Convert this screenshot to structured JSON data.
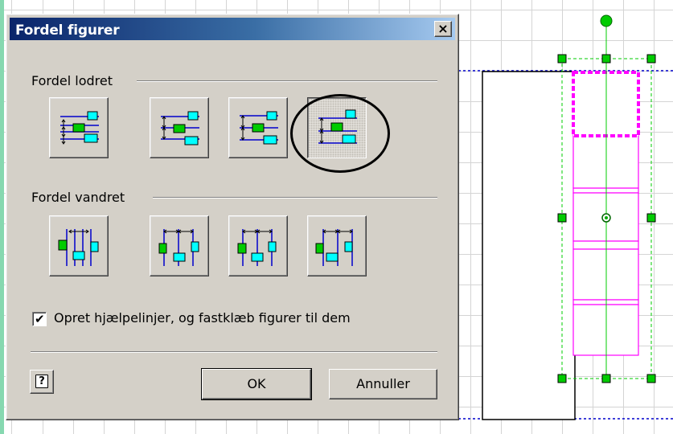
{
  "dialog": {
    "title": "Fordel figurer",
    "close_label": "×",
    "vertical_section_label": "Fordel lodret",
    "horizontal_section_label": "Fordel vandret",
    "vertical_buttons": [
      "distribute-vertical-space-icon",
      "distribute-vertical-top-icon",
      "distribute-vertical-center-icon",
      "distribute-vertical-bottom-icon"
    ],
    "horizontal_buttons": [
      "distribute-horizontal-space-icon",
      "distribute-horizontal-left-icon",
      "distribute-horizontal-center-icon",
      "distribute-horizontal-right-icon"
    ],
    "selected_vertical_option": 4,
    "checkbox": {
      "label": "Opret hjælpelinjer, og fastklæb figurer til dem",
      "checked": true,
      "mark": "✔"
    },
    "help_label": "?",
    "ok_label": "OK",
    "cancel_label": "Annuller"
  },
  "colors": {
    "accent_shape": "#00ffff",
    "green_shape": "#00cc00",
    "guide_line": "#0000cc",
    "selection_magenta": "#ff00ff",
    "selection_handle": "#00cc00"
  }
}
